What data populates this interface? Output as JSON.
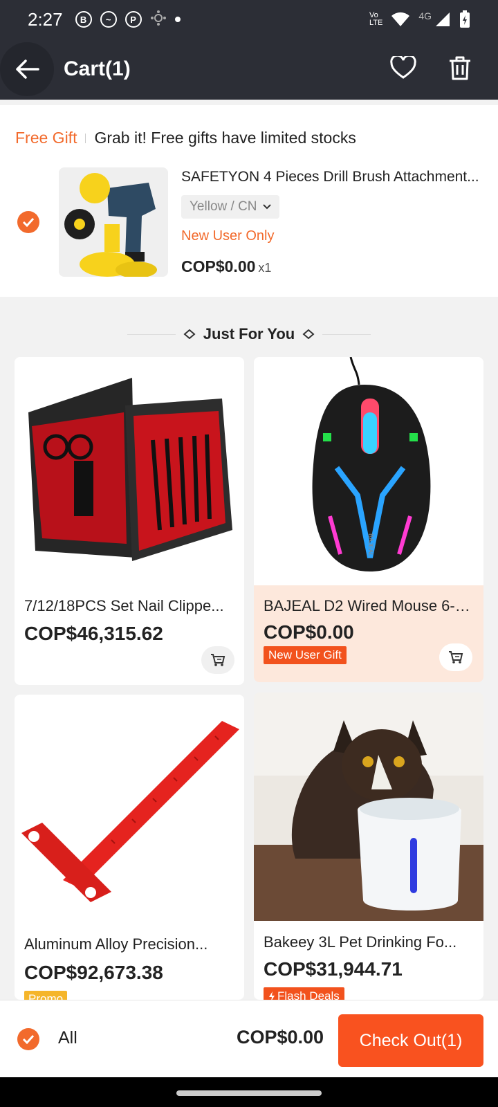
{
  "status": {
    "time": "2:27",
    "network": "4G"
  },
  "header": {
    "title": "Cart(1)"
  },
  "gift": {
    "tag": "Free Gift",
    "message": "Grab it! Free gifts have limited stocks",
    "product_title": "SAFETYON 4 Pieces Drill Brush Attachment...",
    "variant": "Yellow / CN",
    "badge": "New User Only",
    "price": "COP$0.00",
    "qty": "x1"
  },
  "recommend": {
    "title": "Just For You"
  },
  "products": [
    {
      "title": "7/12/18PCS Set Nail Clippe...",
      "price": "COP$46,315.62"
    },
    {
      "title": "BAJEAL D2 Wired Mouse 6-Bu...",
      "price": "COP$0.00",
      "tag": "New User Gift"
    },
    {
      "title": "Aluminum Alloy Precision...",
      "price": "COP$92,673.38",
      "tag": "Promo"
    },
    {
      "title": "Bakeey 3L Pet Drinking Fo...",
      "price": "COP$31,944.71",
      "tag": "Flash Deals"
    }
  ],
  "mouse_brand": "BAJEAL",
  "footer": {
    "all_label": "All",
    "total": "COP$0.00",
    "checkout": "Check Out(1)"
  },
  "colors": {
    "accent": "#f26a2c",
    "header_bg": "#2c2e36",
    "checkout": "#f9521f"
  }
}
